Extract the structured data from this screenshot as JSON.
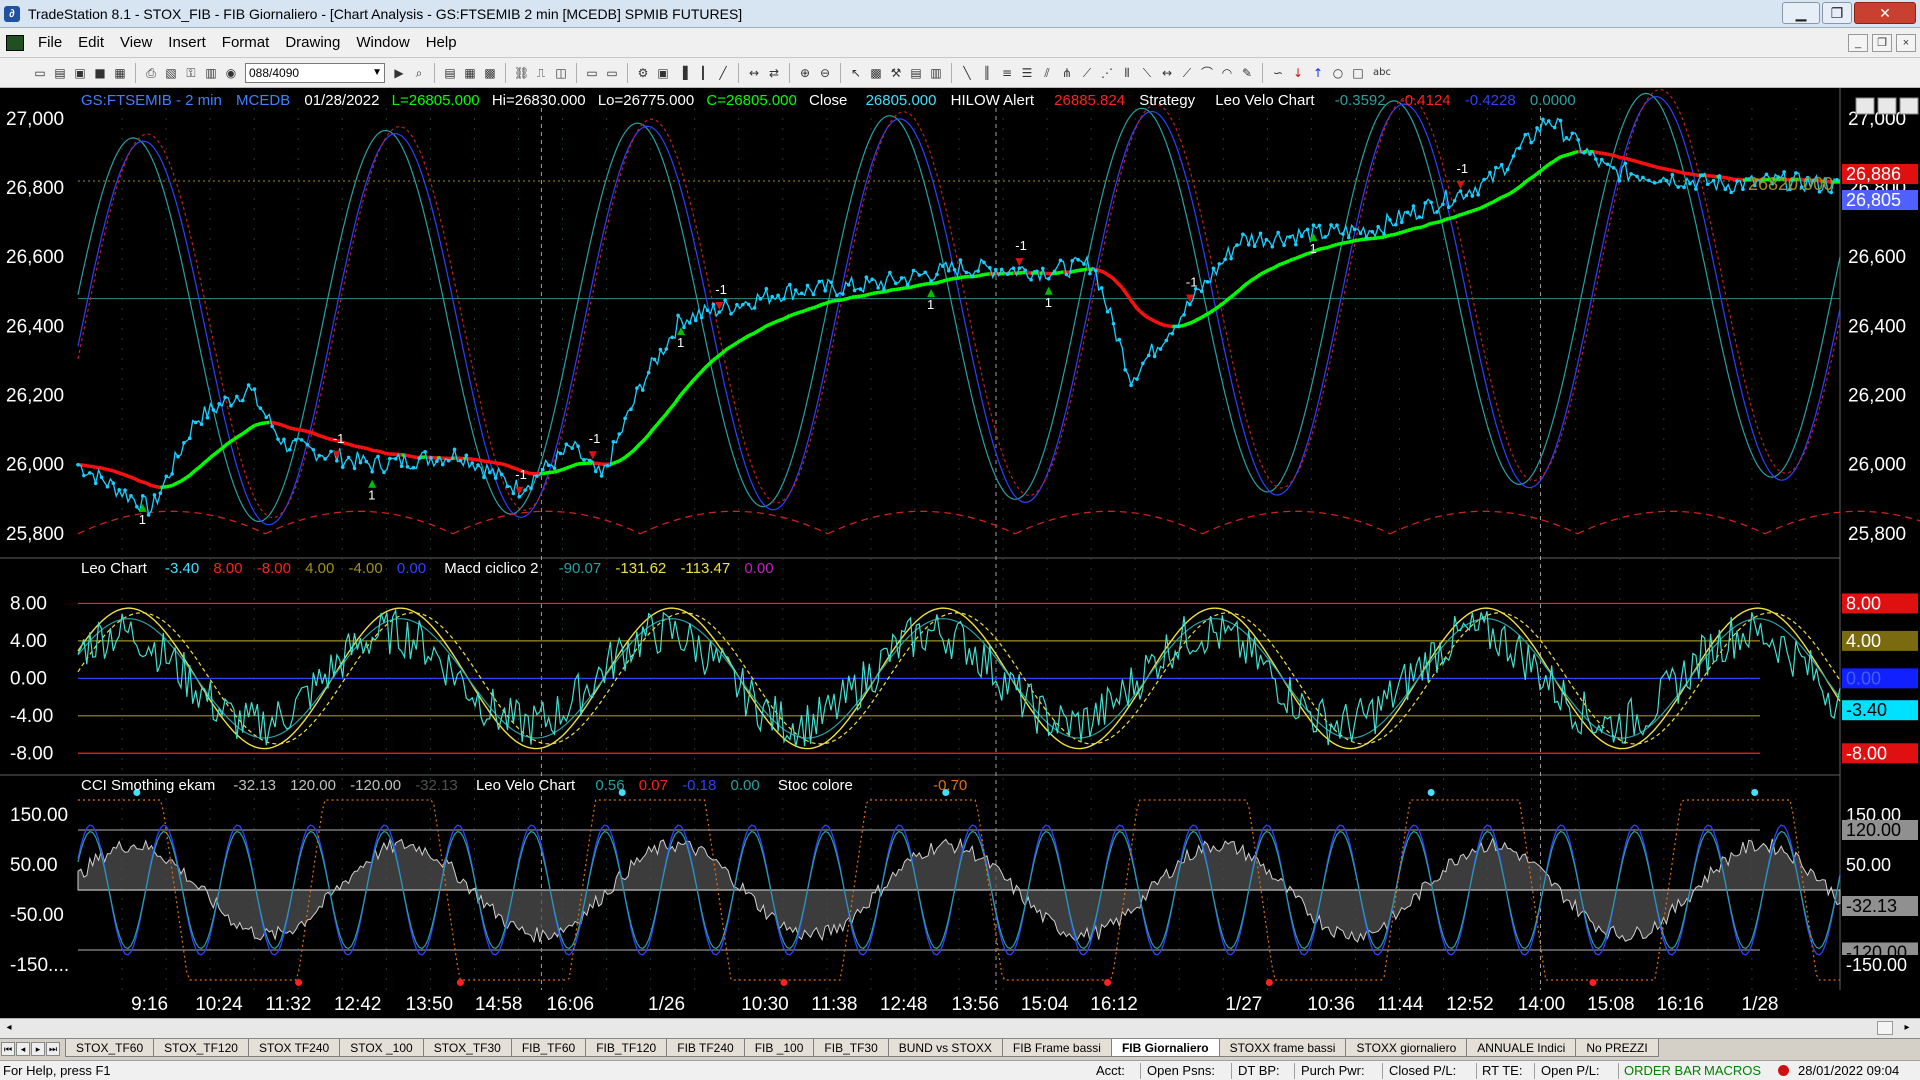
{
  "window": {
    "title": "TradeStation 8.1 - STOX_FIB - FIB Giornaliero - [Chart Analysis - GS:FTSEMIB  2 min  [MCEDB] SPMIB FUTURES]",
    "minimize": "▁",
    "restore": "❐",
    "close": "✕"
  },
  "menu": [
    "File",
    "Edit",
    "View",
    "Insert",
    "Format",
    "Drawing",
    "Window",
    "Help"
  ],
  "toolbar": {
    "bar_count": "088/4090",
    "text_tool": "abc"
  },
  "colors": {
    "price": "#18d0ff",
    "smooth_up": "#00ff00",
    "smooth_down": "#ff1010",
    "grid": "#2a8a8a",
    "osc_cyan": "#40e0d0",
    "osc_yellow": "#f0e040",
    "background": "#000000"
  },
  "chart": {
    "header": {
      "symbol": "GS:FTSEMIB - 2 min",
      "feed": "MCEDB",
      "date": "01/28/2022",
      "last": "L=26805.000",
      "high": "Hi=26830.000",
      "low": "Lo=26775.000",
      "close_eq": "C=26805.000",
      "close_label": "Close",
      "close_val": "26805.000",
      "hilow_label": "HILOW Alert",
      "hilow_val": "26885.824",
      "strategy_label": "Strategy",
      "study_label": "Leo Velo Chart",
      "v1": "-0.3592",
      "v2": "-0.4124",
      "v3": "-0.4228",
      "v4": "0.0000"
    },
    "price_axis": [
      "27,000",
      "26,800",
      "26,600",
      "26,400",
      "26,200",
      "26,000",
      "25,800"
    ],
    "price_tags": {
      "red": "26,886",
      "blue": "26,805",
      "marker": "26820.000"
    },
    "signals": [
      {
        "label": "1",
        "side": "long"
      },
      {
        "label": "-1",
        "side": "short"
      },
      {
        "label": "1",
        "side": "long"
      },
      {
        "label": "-1",
        "side": "short"
      },
      {
        "label": "-1",
        "side": "short"
      },
      {
        "label": "1",
        "side": "long"
      },
      {
        "label": "-1",
        "side": "short"
      },
      {
        "label": "1",
        "side": "long"
      },
      {
        "label": "-1",
        "side": "short"
      },
      {
        "label": "1",
        "side": "long"
      },
      {
        "label": "-1",
        "side": "short"
      },
      {
        "label": "1",
        "side": "long"
      },
      {
        "label": "-1",
        "side": "short"
      }
    ],
    "pane2": {
      "title": "Leo Chart",
      "vals": [
        "-3.40",
        "8.00",
        "-8.00",
        "4.00",
        "-4.00",
        "0.00"
      ],
      "title2": "Macd ciclico 2",
      "vals2": [
        "-90.07",
        "-131.62",
        "-113.47",
        "0.00"
      ],
      "axis": [
        "8.00",
        "4.00",
        "0.00",
        "-4.00",
        "-8.00"
      ],
      "tags": [
        "8.00",
        "4.00",
        "0.00",
        "-3.40",
        "-8.00"
      ]
    },
    "pane3": {
      "title": "CCI Smothing ekam",
      "vals": [
        "-32.13",
        "120.00",
        "-120.00",
        "-32.13"
      ],
      "title2": "Leo Velo Chart",
      "vals2": [
        "0.56",
        "0.07",
        "-0.18",
        "0.00"
      ],
      "title3": "Stoc colore",
      "vals3": [
        "-0.70"
      ],
      "axis": [
        "150.00",
        "50.00",
        "-50.00",
        "-150...."
      ],
      "tags": [
        "150.00",
        "120.00",
        "50.00",
        "-32.13",
        "-120.00",
        "-150.00"
      ]
    },
    "time_axis": [
      "9:16",
      "10:24",
      "11:32",
      "12:42",
      "13:50",
      "14:58",
      "16:06",
      "1/26",
      "10:30",
      "11:38",
      "12:48",
      "13:56",
      "15:04",
      "16:12",
      "1/27",
      "10:36",
      "11:44",
      "12:52",
      "14:00",
      "15:08",
      "16:16",
      "1/28"
    ]
  },
  "tabs": [
    "STOX_TF60",
    "STOX_TF120",
    "STOX TF240",
    "STOX _100",
    "STOX_TF30",
    "FIB_TF60",
    "FIB_TF120",
    "FIB TF240",
    "FIB _100",
    "FIB_TF30",
    "BUND vs STOXX",
    "FIB Frame bassi",
    "FIB Giornaliero",
    "STOXX frame bassi",
    "STOXX giornaliero",
    "ANNUALE Indici",
    "No PREZZI"
  ],
  "active_tab": "FIB Giornaliero",
  "status": {
    "help": "For Help, press F1",
    "acct": "Acct:",
    "open_psns": "Open Psns:",
    "dt_bp": "DT BP:",
    "purch_pwr": "Purch Pwr:",
    "closed_pl": "Closed P/L:",
    "rt_te": "RT TE:",
    "open_pl": "Open P/L:",
    "order_bar": "ORDER BAR",
    "macros": "MACROS",
    "datetime": "28/01/2022 09:04"
  }
}
